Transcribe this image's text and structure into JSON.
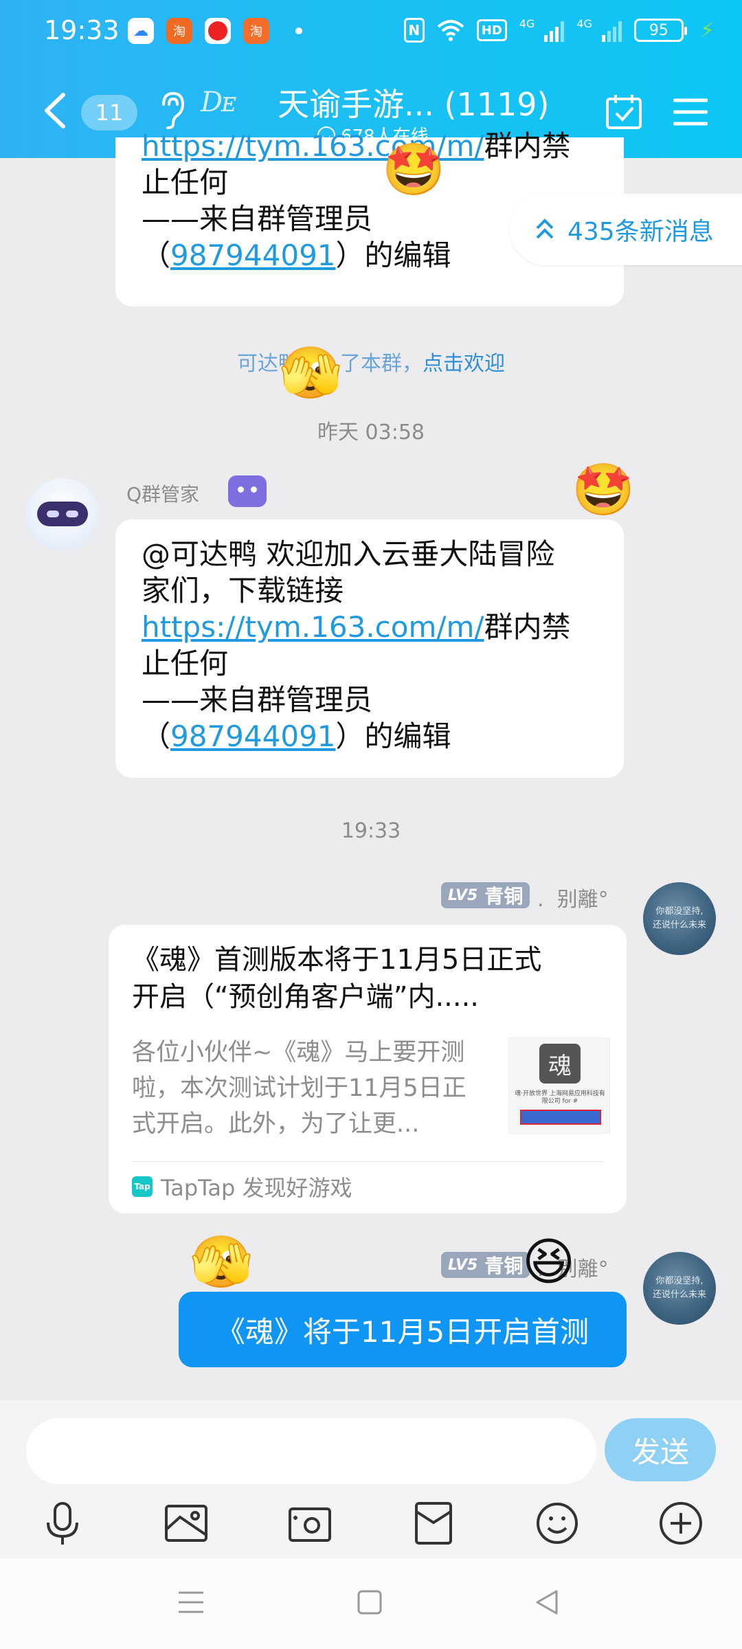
{
  "status_bar": {
    "time": "19:33",
    "battery": "95",
    "network": "4G"
  },
  "header": {
    "back_count": "11",
    "group_title": "天谕手游... (1119)",
    "online_text": "678人在线"
  },
  "new_messages": "435条新消息",
  "messages": {
    "top_bubble": {
      "line1_link": "https://tym.163.com/m/",
      "line1_tail": "群内禁",
      "line2": "止任何",
      "line3": "——来自群管理员",
      "line4_open": "（",
      "line4_link": "987944091",
      "line4_close": "）的编辑"
    },
    "join_notice": {
      "prefix": "可达鸭加入了本群，",
      "action": "点击欢迎"
    },
    "time1": "昨天 03:58",
    "bot": {
      "sender": "Q群管家",
      "line1": "@可达鸭 欢迎加入云垂大陆冒险",
      "line2": "家们，下载链接",
      "link": "https://tym.163.com/m/",
      "link_tail": "群内禁",
      "line4": "止任何",
      "line5": "——来自群管理员",
      "line6_open": "（",
      "line6_link": "987944091",
      "line6_close": "）的编辑"
    },
    "time2": "19:33",
    "user": {
      "level": "LV5",
      "title": "青铜",
      "sep": ".",
      "name": "别離°",
      "avatar_text_1": "你都没坚持,",
      "avatar_text_2": "还说什么未来"
    },
    "card": {
      "title_line1": "《魂》首测版本将于11月5日正式",
      "title_line2": "开启（“预创角客户端”内.....",
      "desc_line1": "各位小伙伴~《魂》马上要开测",
      "desc_line2": "啦，本次测试计划于11月5日正",
      "desc_line3": "式开启。此外，为了让更...",
      "thumb_text": "魂·开放世界 上海网易应用科技有限公司 for #",
      "source_icon": "Tap",
      "source": "TapTap 发现好游戏"
    },
    "my_message": "《魂》将于11月5日开启首测"
  },
  "input": {
    "placeholder": "",
    "send_label": "发送"
  },
  "toolbar_icons": [
    "mic-icon",
    "image-icon",
    "camera-icon",
    "red-packet-icon",
    "emoji-icon",
    "plus-icon"
  ],
  "colors": {
    "header_start": "#2fb2f4",
    "header_end": "#0cc6f5",
    "link": "#1f9ae0",
    "my_bubble": "#0f96f5",
    "send_button": "#8fd0f5"
  }
}
